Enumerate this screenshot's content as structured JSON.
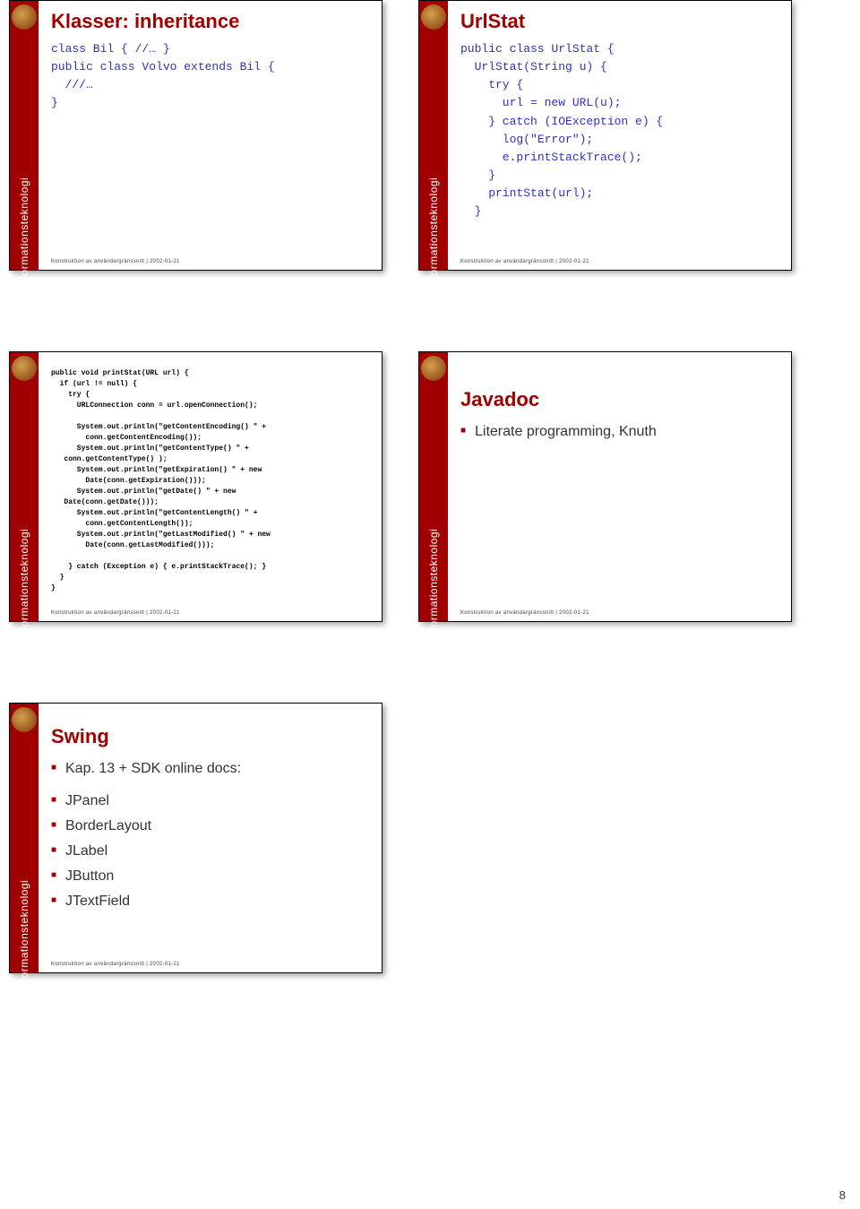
{
  "sidebar_label": "Informationsteknologi",
  "footer_text": "Konstruktion av användargränssnitt | 2002-01-21",
  "page_number": "8",
  "slides": {
    "s1": {
      "title": "Klasser: inheritance",
      "code": "class Bil { //… }\npublic class Volvo extends Bil {\n  ///…\n}"
    },
    "s2": {
      "title": "UrlStat",
      "code": "public class UrlStat {\n  UrlStat(String u) {\n    try {\n      url = new URL(u);\n    } catch (IOException e) {\n      log(\"Error\");\n      e.printStackTrace();\n    }\n    printStat(url);\n  }"
    },
    "s3": {
      "code": "public void printStat(URL url) {\n  if (url != null) {\n    try {\n      URLConnection conn = url.openConnection();\n\n      System.out.println(\"getContentEncoding() \" +\n        conn.getContentEncoding());\n      System.out.println(\"getContentType() \" +\n   conn.getContentType() );\n      System.out.println(\"getExpiration() \" + new\n        Date(conn.getExpiration()));\n      System.out.println(\"getDate() \" + new\n   Date(conn.getDate()));\n      System.out.println(\"getContentLength() \" +\n        conn.getContentLength());\n      System.out.println(\"getLastModified() \" + new\n        Date(conn.getLastModified()));\n\n    } catch (Exception e) { e.printStackTrace(); }\n  }\n}"
    },
    "s4": {
      "title": "Javadoc",
      "bullets": [
        "Literate programming, Knuth"
      ]
    },
    "s5": {
      "title": "Swing",
      "bullets": [
        "Kap. 13 + SDK online docs:",
        "JPanel",
        "BorderLayout",
        "JLabel",
        "JButton",
        "JTextField"
      ]
    }
  }
}
